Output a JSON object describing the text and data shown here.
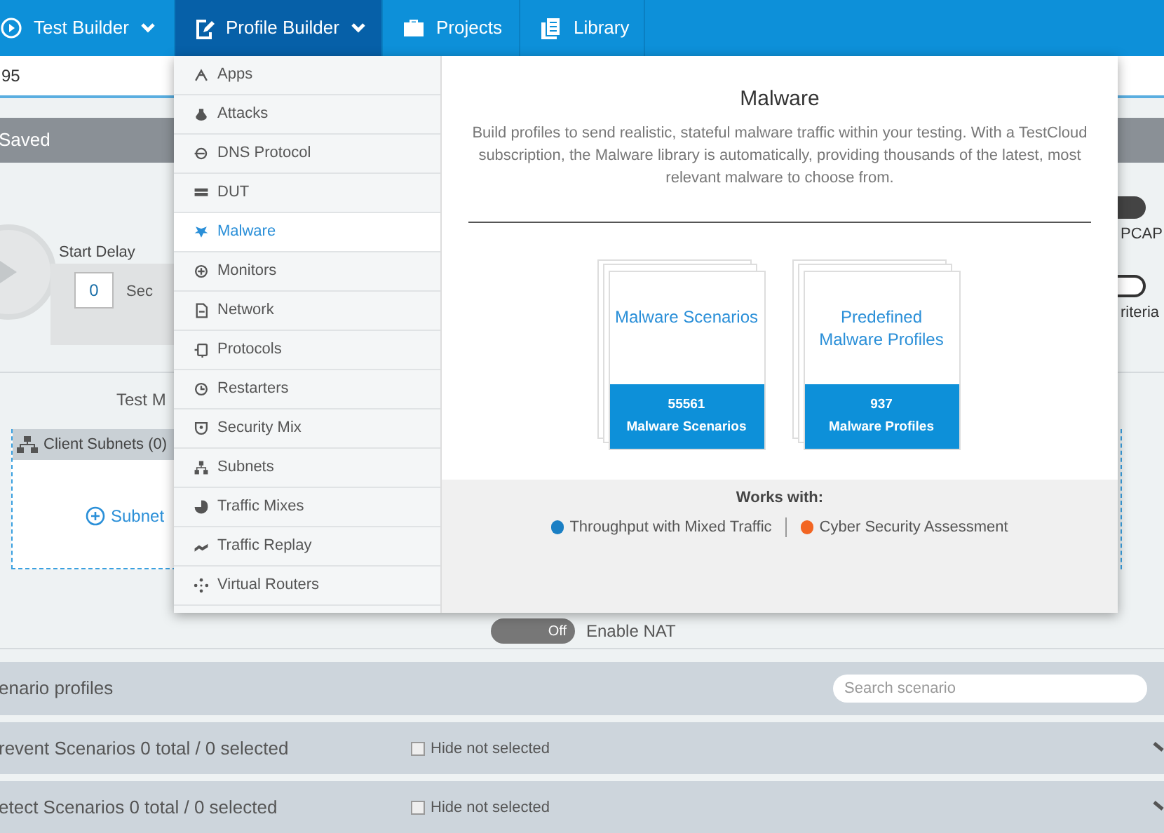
{
  "nav": [
    {
      "label": "Test Builder",
      "selected": false,
      "dropdown": true
    },
    {
      "label": "Profile Builder",
      "selected": true,
      "dropdown": true
    },
    {
      "label": "Projects",
      "selected": false,
      "dropdown": false
    },
    {
      "label": "Library",
      "selected": false,
      "dropdown": false
    }
  ],
  "name_field": {
    "value": "95"
  },
  "status_bar": {
    "label": "Saved"
  },
  "start_delay": {
    "label": "Start Delay",
    "value": "0",
    "unit": "Sec"
  },
  "side_toggles": [
    {
      "label": "PCAP",
      "on": true
    },
    {
      "label": "riteria",
      "on": false
    }
  ],
  "test_mode_heading": "Test M",
  "client_subnets": {
    "title": "Client Subnets (0)",
    "add_link": "Subnet"
  },
  "nat": {
    "state_label": "Off",
    "label": "Enable NAT",
    "on": false
  },
  "scenario_profiles": {
    "title": "enario profiles",
    "search_placeholder": "Search scenario"
  },
  "scenario_groups": [
    {
      "title": "revent Scenarios 0 total / 0 selected",
      "hide_label": "Hide not selected",
      "checked": false
    },
    {
      "title": "etect Scenarios 0 total / 0 selected",
      "hide_label": "Hide not selected",
      "checked": false
    }
  ],
  "menu": {
    "items": [
      {
        "label": "Apps",
        "selected": false
      },
      {
        "label": "Attacks",
        "selected": false
      },
      {
        "label": "DNS Protocol",
        "selected": false
      },
      {
        "label": "DUT",
        "selected": false
      },
      {
        "label": "Malware",
        "selected": true
      },
      {
        "label": "Monitors",
        "selected": false
      },
      {
        "label": "Network",
        "selected": false
      },
      {
        "label": "Protocols",
        "selected": false
      },
      {
        "label": "Restarters",
        "selected": false
      },
      {
        "label": "Security Mix",
        "selected": false
      },
      {
        "label": "Subnets",
        "selected": false
      },
      {
        "label": "Traffic Mixes",
        "selected": false
      },
      {
        "label": "Traffic Replay",
        "selected": false
      },
      {
        "label": "Virtual Routers",
        "selected": false
      }
    ],
    "panel": {
      "title": "Malware",
      "description": "Build profiles to send realistic, stateful malware traffic within your testing. With a TestCloud subscription, the Malware library is automatically, providing thousands of the latest, most relevant malware to choose from.",
      "cards": [
        {
          "title": "Malware Scenarios",
          "count": "55561",
          "caption": "Malware Scenarios"
        },
        {
          "title": "Predefined Malware Profiles",
          "count": "937",
          "caption": "Malware Profiles"
        }
      ],
      "works_with": {
        "label": "Works with:",
        "items": [
          {
            "label": "Throughput with Mixed Traffic",
            "color": "#1a7fc4"
          },
          {
            "label": "Cyber Security Assessment",
            "color": "#f26522"
          }
        ]
      }
    }
  }
}
